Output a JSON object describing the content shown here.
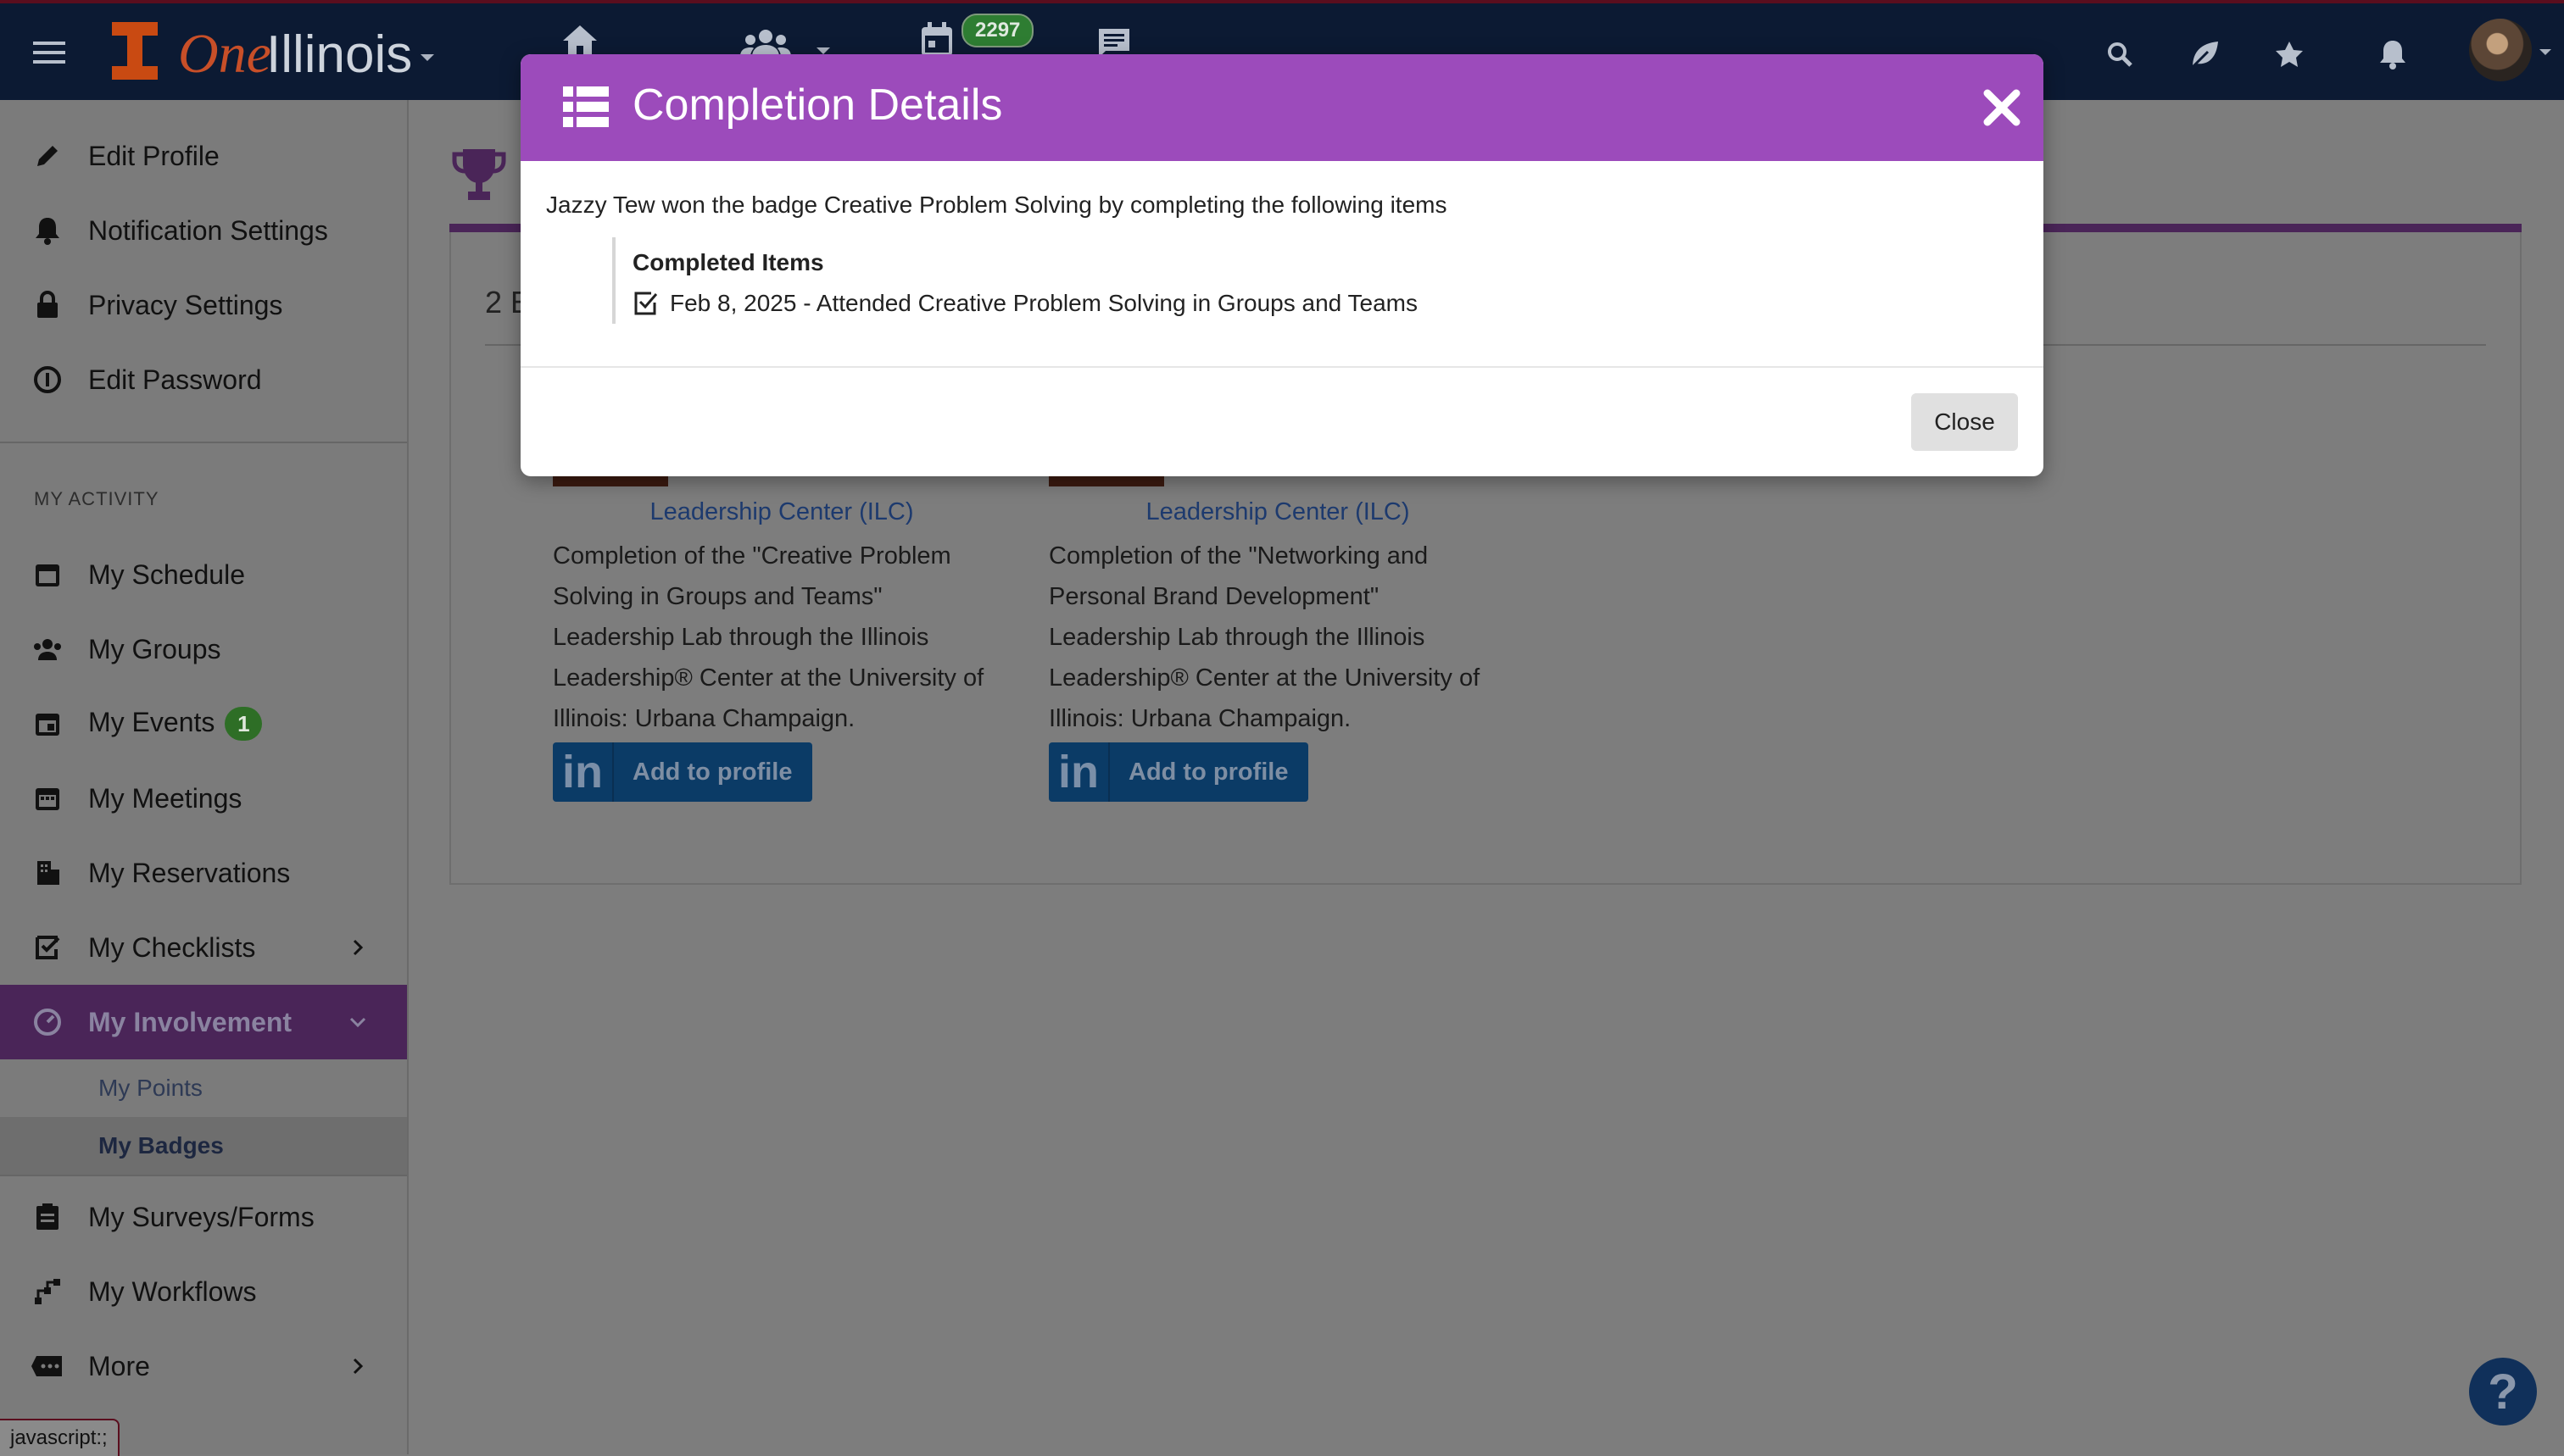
{
  "topbar": {
    "brand_one": "One",
    "brand_name": "Illinois",
    "calendar_badge": "2297",
    "icons": [
      "menu-icon",
      "home-icon",
      "groups-icon",
      "calendar-icon",
      "chat-icon",
      "search-icon",
      "leaf-icon",
      "star-icon",
      "bell-icon"
    ]
  },
  "sidebar": {
    "top_items": [
      {
        "label": "Edit Profile",
        "icon": "pencil-icon"
      },
      {
        "label": "Notification Settings",
        "icon": "bell-icon"
      },
      {
        "label": "Privacy Settings",
        "icon": "lock-icon"
      },
      {
        "label": "Edit Password",
        "icon": "info-icon"
      }
    ],
    "section_label": "MY ACTIVITY",
    "activity_items": [
      {
        "label": "My Schedule",
        "icon": "calendar-icon"
      },
      {
        "label": "My Groups",
        "icon": "people-icon"
      },
      {
        "label": "My Events",
        "icon": "event-icon",
        "badge": "1"
      },
      {
        "label": "My Meetings",
        "icon": "calendar-grid-icon"
      },
      {
        "label": "My Reservations",
        "icon": "building-icon"
      },
      {
        "label": "My Checklists",
        "icon": "checklist-icon"
      },
      {
        "label": "My Involvement",
        "icon": "gauge-icon"
      }
    ],
    "sub_items": [
      {
        "label": "My Points"
      },
      {
        "label": "My Badges"
      }
    ],
    "bottom_items": [
      {
        "label": "My Surveys/Forms",
        "icon": "clipboard-icon"
      },
      {
        "label": "My Workflows",
        "icon": "workflow-icon"
      },
      {
        "label": "More",
        "icon": "more-icon"
      }
    ]
  },
  "main": {
    "heading_fragment": "2 E",
    "cards": [
      {
        "org": "Leadership Center (ILC)",
        "description": "Completion of the \"Creative Problem Solving in Groups and Teams\" Leadership Lab through the Illinois Leadership® Center at the University of Illinois: Urbana Champaign.",
        "button": "Add to profile",
        "button_logo": "in"
      },
      {
        "org": "Leadership Center (ILC)",
        "description": "Completion of the \"Networking and Personal Brand Development\" Leadership Lab through the Illinois Leadership® Center at the University of Illinois: Urbana Champaign.",
        "button": "Add to profile",
        "button_logo": "in"
      }
    ]
  },
  "modal": {
    "title": "Completion Details",
    "intro": "Jazzy Tew won the badge Creative Problem Solving by completing the following items",
    "completed_title": "Completed Items",
    "completed_item": "Feb 8, 2025 - Attended Creative Problem Solving in Groups and Teams",
    "close_label": "Close"
  },
  "status_tip": "javascript:;",
  "help": "?",
  "colors": {
    "topbar": "#0c1a33",
    "modal_header": "#9c4bbb",
    "active_item": "#4a2558",
    "linkedin": "#0b3b66"
  }
}
